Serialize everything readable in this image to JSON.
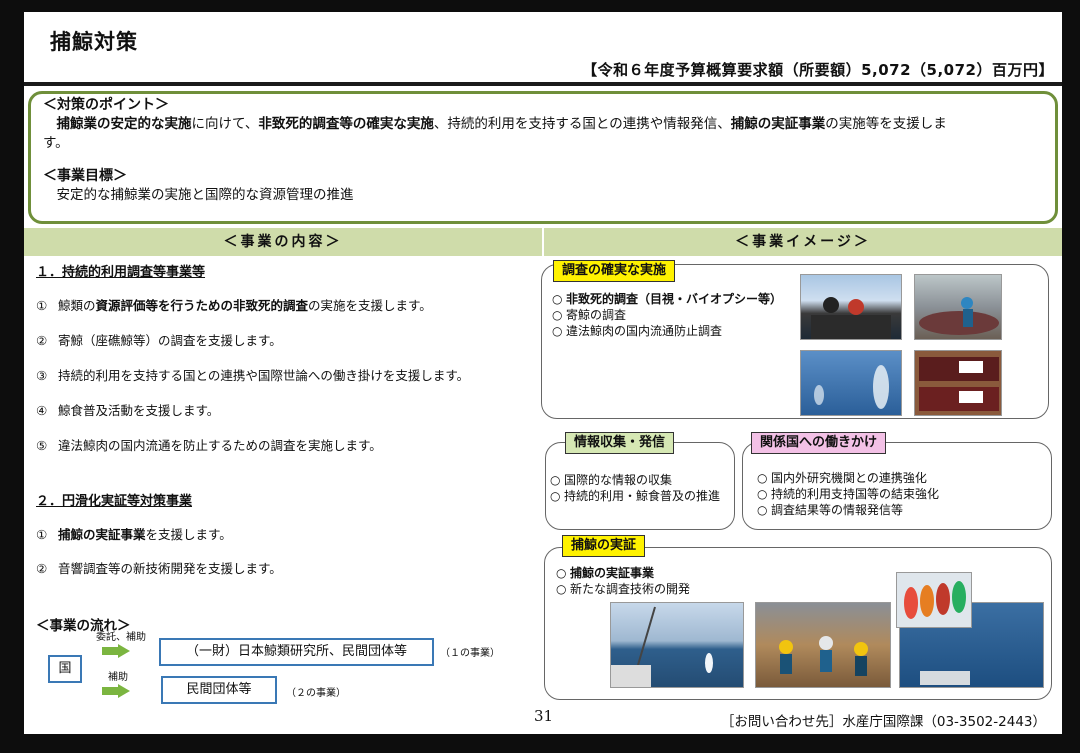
{
  "header": {
    "title": "捕鯨対策",
    "budget": "【令和６年度予算概算要求額（所要額）5,072（5,072）百万円】"
  },
  "points": {
    "heading": "＜対策のポイント＞",
    "text_parts": [
      {
        "t": "捕鯨業の安定的な実施",
        "b": true
      },
      {
        "t": "に向けて、",
        "b": false
      },
      {
        "t": "非致死的調査等の確実な実施",
        "b": true
      },
      {
        "t": "、持続的利用を支持する国との連携や情報発信、",
        "b": false
      },
      {
        "t": "捕鯨の実証事業",
        "b": true
      },
      {
        "t": "の実施等を支援しま",
        "b": false
      }
    ],
    "text_wrap": "す。",
    "goal_heading": "＜事業目標＞",
    "goal_text": "安定的な捕鯨業の実施と国際的な資源管理の推進"
  },
  "bars": {
    "left": "＜事業の内容＞",
    "right": "＜事業イメージ＞"
  },
  "content": {
    "section1": "１．持続的利用調査等事業等",
    "items1": [
      {
        "n": "①",
        "parts": [
          {
            "t": "鯨類の",
            "b": false
          },
          {
            "t": "資源評価等を行うための非致死的調査",
            "b": true
          },
          {
            "t": "の実施を支援します。",
            "b": false
          }
        ]
      },
      {
        "n": "②",
        "parts": [
          {
            "t": "寄鯨（座礁鯨等）の調査を支援します。",
            "b": false
          }
        ]
      },
      {
        "n": "③",
        "parts": [
          {
            "t": "持続的利用を支持する国との連携や国際世論への働き掛けを支援します。",
            "b": false
          }
        ]
      },
      {
        "n": "④",
        "parts": [
          {
            "t": "鯨食普及活動を支援します。",
            "b": false
          }
        ]
      },
      {
        "n": "⑤",
        "parts": [
          {
            "t": "違法鯨肉の国内流通を防止するための調査を実施します。",
            "b": false
          }
        ]
      }
    ],
    "section2": "２．円滑化実証等対策事業",
    "items2": [
      {
        "n": "①",
        "parts": [
          {
            "t": "捕鯨の実証事業",
            "b": true
          },
          {
            "t": "を支援します。",
            "b": false
          }
        ]
      },
      {
        "n": "②",
        "parts": [
          {
            "t": "音響調査等の新技術開発を支援します。",
            "b": false
          }
        ]
      }
    ]
  },
  "flow": {
    "heading": "＜事業の流れ＞",
    "country": "国",
    "arrow1_label": "委託、補助",
    "arrow2_label": "補助",
    "box1": "（一財）日本鯨類研究所、民間団体等",
    "box1_note": "（１の事業）",
    "box2": "民間団体等",
    "box2_note": "（２の事業）"
  },
  "image_panels": {
    "survey": {
      "tag": "調査の確実な実施",
      "items": [
        {
          "t": "非致死的調査（目視・バイオプシー等）",
          "b": true
        },
        {
          "t": "寄鯨の調査",
          "b": false
        },
        {
          "t": "違法鯨肉の国内流通防止調査",
          "b": false
        }
      ]
    },
    "info": {
      "tag": "情報収集・発信",
      "items": [
        "国際的な情報の収集",
        "持続的利用・鯨食普及の推進"
      ]
    },
    "relations": {
      "tag": "関係国への働きかけ",
      "items": [
        "国内外研究機関との連携強化",
        "持続的利用支持国等の結束強化",
        "調査結果等の情報発信等"
      ]
    },
    "demo": {
      "tag": "捕鯨の実証",
      "items": [
        {
          "t": "捕鯨の実証事業",
          "b": true
        },
        {
          "t": "新たな調査技術の開発",
          "b": false
        }
      ]
    }
  },
  "footer": {
    "page": "31",
    "contact": "［お問い合わせ先］水産庁国際課（03-3502-2443）"
  },
  "colors": {
    "points_border": "#6f8f3a",
    "bar_bg": "#cfdcaa",
    "tag_yellow": "#fff200",
    "tag_green": "#d6e8b4",
    "tag_pink": "#f3c1e6",
    "arrow": "#7bb540",
    "box_border": "#3a78b5"
  }
}
